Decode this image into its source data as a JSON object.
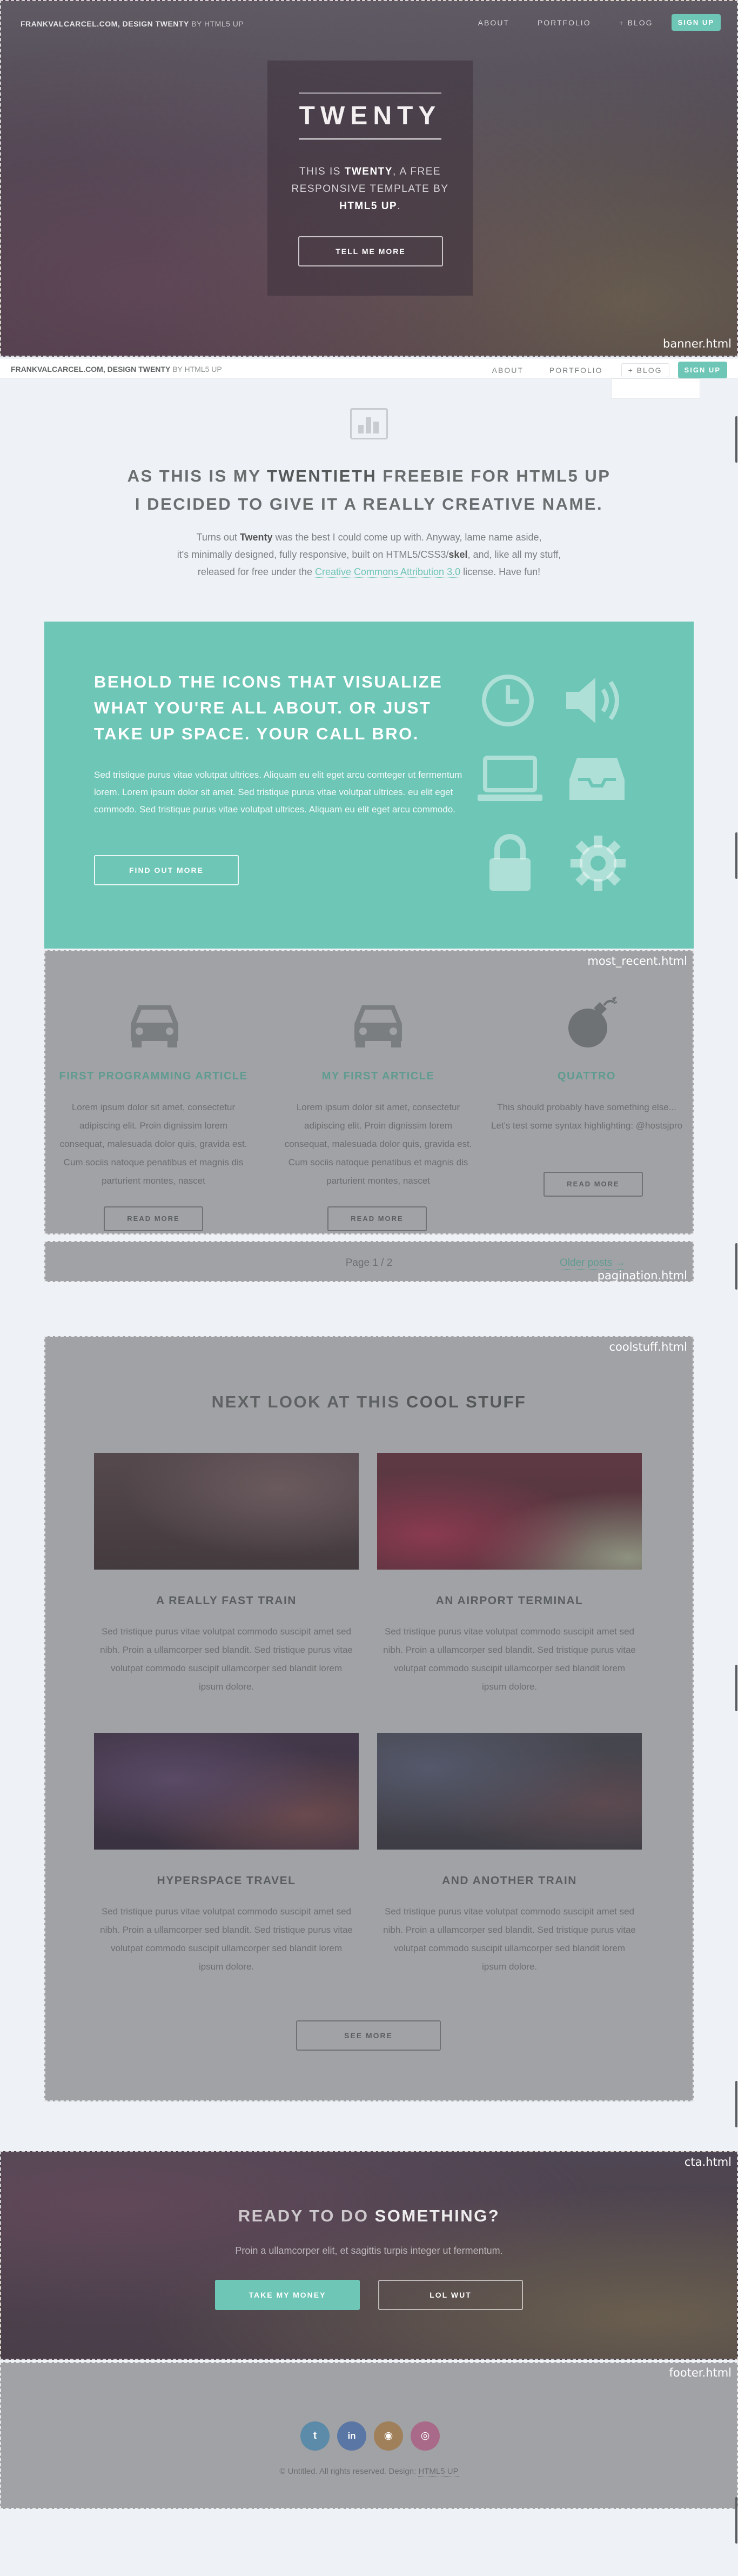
{
  "banner": {
    "tag": "banner.html",
    "brand_bold": "FRANKVALCARCEL.COM, DESIGN TWENTY",
    "brand_light": "BY HTML5 UP",
    "nav": [
      "ABOUT",
      "PORTFOLIO",
      "+ BLOG"
    ],
    "signup": "SIGN UP",
    "title": "TWENTY",
    "text_1": "THIS IS ",
    "text_bold": "TWENTY",
    "text_2": ", A FREE RESPONSIVE TEMPLATE BY ",
    "text_bold2": "HTML5 UP",
    "text_3": ".",
    "button": "TELL ME MORE"
  },
  "sticky_header": {
    "brand_bold": "FRANKVALCARCEL.COM, DESIGN TWENTY",
    "brand_light": "BY HTML5 UP",
    "nav": [
      "ABOUT",
      "PORTFOLIO",
      "+ BLOG"
    ],
    "signup": "SIGN UP"
  },
  "intro": {
    "icon": "bar-chart-icon",
    "head_1": "AS THIS IS MY ",
    "head_bold": "TWENTIETH",
    "head_2": " FREEBIE FOR HTML5 UP",
    "head_line2": "I DECIDED TO GIVE IT A REALLY CREATIVE NAME.",
    "text_1": "Turns out ",
    "text_bold": "Twenty",
    "text_2": " was the best I could come up with. Anyway, lame name aside,",
    "text_line2_a": "it's minimally designed, fully responsive, built on HTML5/CSS3/",
    "text_line2_bold": "skel",
    "text_line2_b": ", and, like all my stuff,",
    "text_line3_a": "released for free under the ",
    "text_link": "Creative Commons Attribution 3.0",
    "text_line3_b": " license. Have fun!"
  },
  "icons_box": {
    "head_1": "BEHOLD THE ",
    "head_bold": "ICONS",
    "head_2": " THAT VISUALIZE WHAT YOU'RE ALL ABOUT. OR JUST TAKE UP SPACE. YOUR CALL BRO.",
    "text": "Sed tristique purus vitae volutpat ultrices. Aliquam eu elit eget arcu comteger ut fermentum lorem. Lorem ipsum dolor sit amet. Sed tristique purus vitae volutpat ultrices. eu elit eget commodo. Sed tristique purus vitae volutpat ultrices. Aliquam eu elit eget arcu commodo.",
    "button": "FIND OUT MORE",
    "icons": [
      "clock-icon",
      "volume-icon",
      "laptop-icon",
      "inbox-icon",
      "lock-icon",
      "gear-icon"
    ]
  },
  "most_recent": {
    "tag": "most_recent.html",
    "items": [
      {
        "icon": "car-icon",
        "title": "FIRST PROGRAMMING ARTICLE",
        "text": "Lorem ipsum dolor sit amet, consectetur adipiscing elit. Proin dignissim lorem consequat, malesuada dolor quis, gravida est. Cum sociis natoque penatibus et magnis dis parturient montes, nascet",
        "button": "READ MORE"
      },
      {
        "icon": "car-icon",
        "title": "MY FIRST ARTICLE",
        "text": "Lorem ipsum dolor sit amet, consectetur adipiscing elit. Proin dignissim lorem consequat, malesuada dolor quis, gravida est. Cum sociis natoque penatibus et magnis dis parturient montes, nascet",
        "button": "READ MORE"
      },
      {
        "icon": "bomb-icon",
        "title": "QUATTRO",
        "text": "This should probably have something else... Let's test some syntax highlighting: @hostsjpro",
        "button": "READ MORE"
      }
    ]
  },
  "pagination": {
    "tag": "pagination.html",
    "page": "Page 1 / 2",
    "older": "Older posts →"
  },
  "coolstuff": {
    "tag": "coolstuff.html",
    "head_1": "NEXT LOOK AT THIS ",
    "head_bold": "COOL STUFF",
    "items": [
      {
        "title": "A REALLY FAST TRAIN",
        "text": "Sed tristique purus vitae volutpat commodo suscipit amet sed nibh. Proin a ullamcorper sed blandit. Sed tristique purus vitae volutpat commodo suscipit ullamcorper sed blandit lorem ipsum dolore.",
        "color": "#4d4446"
      },
      {
        "title": "AN AIRPORT TERMINAL",
        "text": "Sed tristique purus vitae volutpat commodo suscipit amet sed nibh. Proin a ullamcorper sed blandit. Sed tristique purus vitae volutpat commodo suscipit ullamcorper sed blandit lorem ipsum dolore.",
        "color": "#5b3640"
      },
      {
        "title": "HYPERSPACE TRAVEL",
        "text": "Sed tristique purus vitae volutpat commodo suscipit amet sed nibh. Proin a ullamcorper sed blandit. Sed tristique purus vitae volutpat commodo suscipit ullamcorper sed blandit lorem ipsum dolore.",
        "color": "#3f3a48"
      },
      {
        "title": "AND ANOTHER TRAIN",
        "text": "Sed tristique purus vitae volutpat commodo suscipit amet sed nibh. Proin a ullamcorper sed blandit. Sed tristique purus vitae volutpat commodo suscipit ullamcorper sed blandit lorem ipsum dolore.",
        "color": "#45464f"
      }
    ],
    "button": "SEE MORE"
  },
  "cta": {
    "tag": "cta.html",
    "head_1": "READY TO DO ",
    "head_bold": "SOMETHING?",
    "text": "Proin a ullamcorper elit, et sagittis turpis integer ut fermentum.",
    "button_primary": "TAKE MY MONEY",
    "button_secondary": "LOL WUT"
  },
  "footer": {
    "tag": "footer.html",
    "social": [
      {
        "icon": "twitter-icon",
        "glyph": "t",
        "color": "#5b8ba8"
      },
      {
        "icon": "linkedin-icon",
        "glyph": "in",
        "color": "#5a76a4"
      },
      {
        "icon": "github-icon",
        "glyph": "◉",
        "color": "#a0805a"
      },
      {
        "icon": "dribbble-icon",
        "glyph": "◎",
        "color": "#a86a88"
      }
    ],
    "copyright_1": "© Untitled. All rights reserved. Design: ",
    "copyright_link": "HTML5 UP"
  },
  "colors": {
    "accent": "#6ec6b6",
    "page_bg": "#eef1f6",
    "panel_gray": "#a0a2a5"
  }
}
